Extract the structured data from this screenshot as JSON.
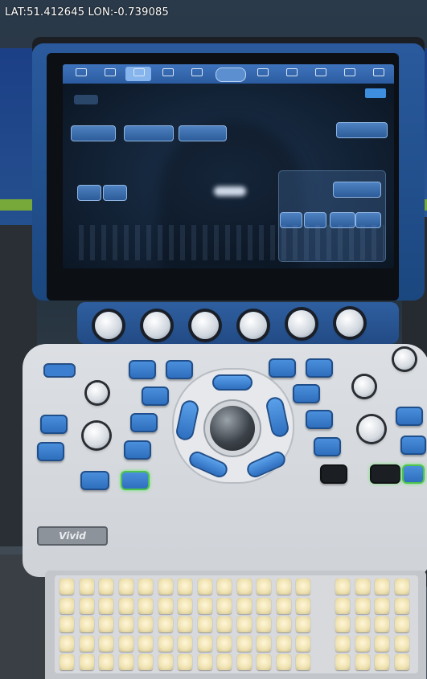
{
  "overlay": {
    "gps_text": "LAT:51.412645 LON:-0.739085"
  },
  "device": {
    "logo_text": "Vivid",
    "accent_color": "#2f6fbd",
    "frame_color": "#1f4e8a"
  }
}
